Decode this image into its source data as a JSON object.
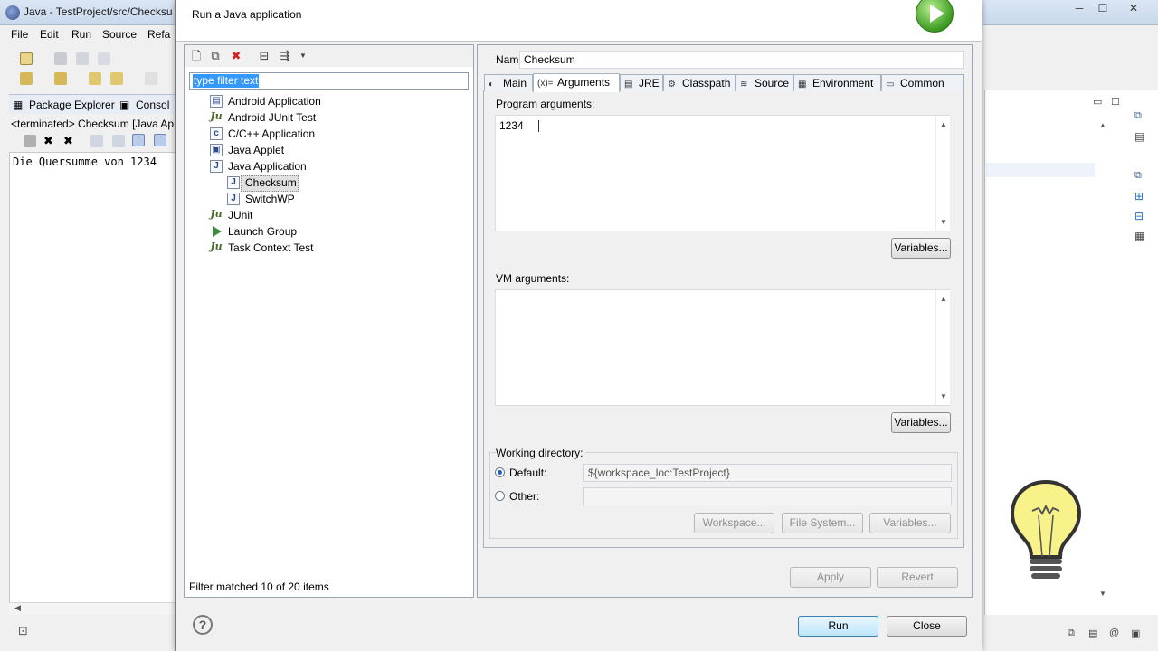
{
  "eclipse": {
    "title": "Java - TestProject/src/Checksu",
    "menu": [
      "File",
      "Edit",
      "Run",
      "Source",
      "Refa"
    ],
    "tabs": [
      "Package Explorer",
      "Consol"
    ],
    "console_status": "<terminated> Checksum [Java Ap",
    "console_output": "Die Quersumme von 1234"
  },
  "dialog": {
    "title": "Run a Java application",
    "filter_placeholder": "type filter text",
    "tree": [
      {
        "label": "Android Application",
        "icon": "android-app-icon"
      },
      {
        "label": "Android JUnit Test",
        "icon": "junit-icon"
      },
      {
        "label": "C/C++ Application",
        "icon": "c-app-icon"
      },
      {
        "label": "Java Applet",
        "icon": "java-applet-icon"
      },
      {
        "label": "Java Application",
        "icon": "java-app-icon"
      },
      {
        "label": "Checksum",
        "icon": "java-file-icon"
      },
      {
        "label": "SwitchWP",
        "icon": "java-file-icon"
      },
      {
        "label": "JUnit",
        "icon": "junit-icon"
      },
      {
        "label": "Launch Group",
        "icon": "launch-group-icon"
      },
      {
        "label": "Task Context Test",
        "icon": "junit-icon"
      }
    ],
    "filter_status": "Filter matched 10 of 20 items",
    "name_label": "Name:",
    "name_value": "Checksum",
    "tabs": [
      {
        "label": "Main",
        "icon": "main-tab-icon"
      },
      {
        "label": "Arguments",
        "icon": "arguments-tab-icon"
      },
      {
        "label": "JRE",
        "icon": "jre-tab-icon"
      },
      {
        "label": "Classpath",
        "icon": "classpath-tab-icon"
      },
      {
        "label": "Source",
        "icon": "source-tab-icon"
      },
      {
        "label": "Environment",
        "icon": "environment-tab-icon"
      },
      {
        "label": "Common",
        "icon": "common-tab-icon"
      }
    ],
    "tab_glyphs": {
      "main": "◐",
      "arguments": "(x)=",
      "jre": "▤",
      "classpath": "⚙",
      "source": "≋",
      "environment": "▦",
      "common": "▭"
    },
    "program_args_label": "Program arguments:",
    "program_args_value": "1234",
    "vm_args_label": "VM arguments:",
    "vm_args_value": "",
    "variables_label": "Variables...",
    "working_dir_label": "Working directory:",
    "default_label": "Default:",
    "default_value": "${workspace_loc:TestProject}",
    "other_label": "Other:",
    "other_value": "",
    "workspace_label": "Workspace...",
    "filesystem_label": "File System...",
    "apply_label": "Apply",
    "revert_label": "Revert",
    "run_label": "Run",
    "close_label": "Close"
  },
  "colors": {
    "selection": "#3399ff",
    "run_green": "#3c9a22"
  }
}
